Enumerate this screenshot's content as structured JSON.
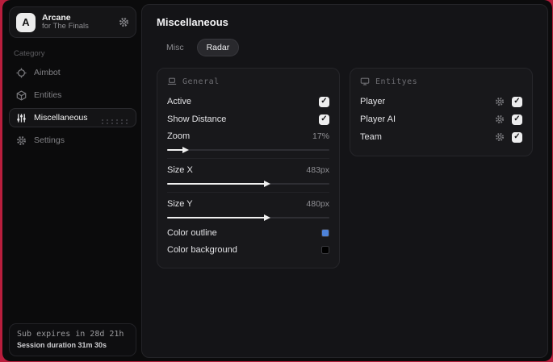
{
  "app": {
    "name": "Arcane",
    "subtitle": "for The Finals",
    "logo_letter": "A"
  },
  "sidebar": {
    "category_label": "Category",
    "items": [
      {
        "label": "Aimbot",
        "icon": "crosshair-icon",
        "active": false
      },
      {
        "label": "Entities",
        "icon": "cube-icon",
        "active": false
      },
      {
        "label": "Miscellaneous",
        "icon": "sliders-icon",
        "active": true
      },
      {
        "label": "Settings",
        "icon": "gear-icon",
        "active": false
      }
    ],
    "footer": {
      "sub_expires": "Sub expires in 28d 21h",
      "session_duration": "Session duration 31m 30s"
    }
  },
  "main": {
    "title": "Miscellaneous",
    "tabs": [
      {
        "label": "Misc",
        "active": false
      },
      {
        "label": "Radar",
        "active": true
      }
    ],
    "general_panel": {
      "header": "General",
      "toggles": [
        {
          "label": "Active",
          "checked": true
        },
        {
          "label": "Show Distance",
          "checked": true
        }
      ],
      "sliders": [
        {
          "label": "Zoom",
          "value": "17%",
          "fill": "10%"
        },
        {
          "label": "Size X",
          "value": "483px",
          "fill": "60%"
        },
        {
          "label": "Size Y",
          "value": "480px",
          "fill": "60%"
        }
      ],
      "colors": [
        {
          "label": "Color outline",
          "hex": "#4d82d9"
        },
        {
          "label": "Color background",
          "hex": "#000000"
        }
      ]
    },
    "entities_panel": {
      "header": "Entityes",
      "rows": [
        {
          "label": "Player",
          "checked": true
        },
        {
          "label": "Player AI",
          "checked": true
        },
        {
          "label": "Team",
          "checked": true
        }
      ]
    }
  }
}
